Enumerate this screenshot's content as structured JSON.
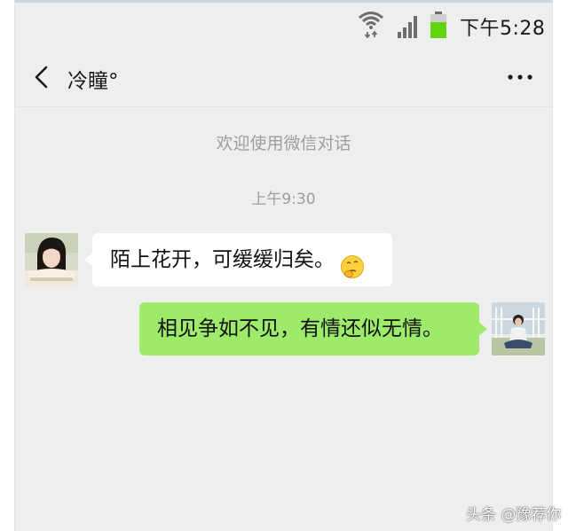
{
  "status_bar": {
    "time": "下午5:28",
    "icons": [
      "wifi-icon",
      "signal-icon",
      "battery-icon"
    ],
    "battery_color": "#5fd40f"
  },
  "header": {
    "back_icon": "chevron-left-icon",
    "title": "冷瞳°",
    "more_icon": "more-horizontal-icon"
  },
  "chat": {
    "welcome": "欢迎使用微信对话",
    "timestamp": "上午9:30",
    "messages": [
      {
        "side": "left",
        "text": "陌上花开，可缓缓归矣。",
        "emoji": "thinking-emoji-icon",
        "bubble_color": "#ffffff",
        "avatar": "avatar-girl"
      },
      {
        "side": "right",
        "text": "相见争如不见，有情还似无情。",
        "bubble_color": "#9eea6a",
        "avatar": "avatar-boy"
      }
    ]
  },
  "watermark": "头条 @豫荐你",
  "colors": {
    "background": "#eeeeee",
    "sent_bubble": "#9eea6a",
    "received_bubble": "#ffffff",
    "system_text": "#9e9e9e"
  }
}
